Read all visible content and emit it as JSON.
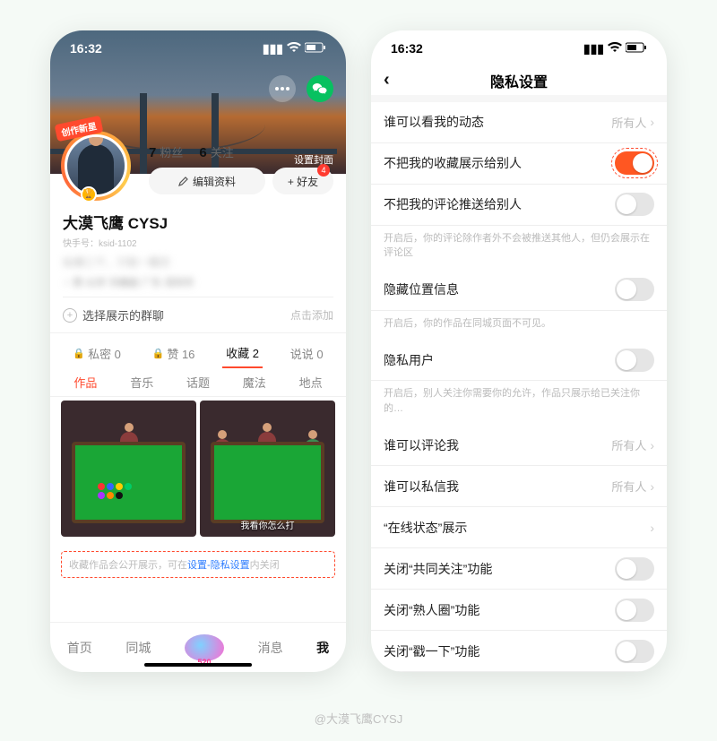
{
  "credit": "@大漠飞鹰CYSJ",
  "status": {
    "time": "16:32"
  },
  "left": {
    "cover_set": "设置封面",
    "badge": "创作新星",
    "stats": {
      "fans_n": "7",
      "fans_l": "粉丝",
      "follow_n": "6",
      "follow_l": "关注"
    },
    "edit": "编辑资料",
    "friend": "+ 好友",
    "friend_badge": "4",
    "name": "大漠飞鹰 CYSJ",
    "sub_id": "快手号：ksid-1102",
    "blur_line": "纵横三千，只取一瓢饮",
    "tag_line": "♂ 男    32岁    天蝎座    广东·深圳市",
    "group": {
      "label": "选择展示的群聊",
      "hint": "点击添加"
    },
    "tabs1": [
      {
        "label": "私密 0"
      },
      {
        "label": "赞 16"
      },
      {
        "label": "收藏 2",
        "active": true
      },
      {
        "label": "说说 0"
      }
    ],
    "tabs2": [
      {
        "label": "作品",
        "active": true
      },
      {
        "label": "音乐"
      },
      {
        "label": "话题"
      },
      {
        "label": "魔法"
      },
      {
        "label": "地点"
      }
    ],
    "thumb_caption": "我看你怎么打",
    "note_pre": "收藏作品会公开展示，可在",
    "note_link": "设置-隐私设置",
    "note_post": "内关闭",
    "nav": [
      "首页",
      "同城",
      "",
      "消息",
      "我"
    ]
  },
  "right": {
    "title": "隐私设置",
    "row_who_feed": {
      "t": "谁可以看我的动态",
      "v": "所有人"
    },
    "row_hide_fav": {
      "t": "不把我的收藏展示给别人"
    },
    "row_hide_cmt": {
      "t": "不把我的评论推送给别人"
    },
    "desc_cmt": "开启后，你的评论除作者外不会被推送其他人，但仍会展示在评论区",
    "row_hide_loc": {
      "t": "隐藏位置信息"
    },
    "desc_loc": "开启后，你的作品在同城页面不可见。",
    "row_priv_user": {
      "t": "隐私用户"
    },
    "desc_priv": "开启后，别人关注你需要你的允许，作品只展示给已关注你的…",
    "row_who_cmt": {
      "t": "谁可以评论我",
      "v": "所有人"
    },
    "row_who_dm": {
      "t": "谁可以私信我",
      "v": "所有人"
    },
    "row_online": {
      "t": "“在线状态”展示"
    },
    "row_mutual": {
      "t": "关闭“共同关注”功能"
    },
    "row_close_friend": {
      "t": "关闭“熟人圈”功能"
    },
    "row_poke": {
      "t": "关闭“戳一下”功能"
    }
  }
}
